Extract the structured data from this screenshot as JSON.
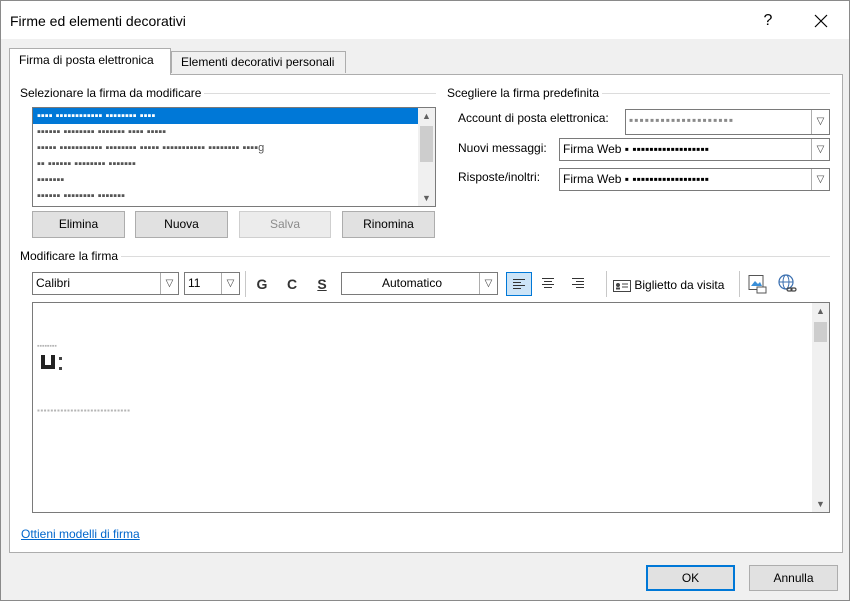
{
  "window": {
    "title": "Firme ed elementi decorativi",
    "help": "?",
    "close": "✕"
  },
  "tabs": [
    {
      "label": "Firma di posta elettronica",
      "active": true
    },
    {
      "label": "Elementi decorativi personali",
      "active": false
    }
  ],
  "select_group": {
    "label": "Selezionare la firma da modificare",
    "items": [
      "▪▪▪▪ ▪▪▪▪▪▪▪▪▪▪▪▪ ▪▪▪▪▪▪▪▪ ▪▪▪▪",
      "▪▪▪▪▪▪ ▪▪▪▪▪▪▪▪ ▪▪▪▪▪▪▪ ▪▪▪▪ ▪▪▪▪▪",
      "▪▪▪▪▪ ▪▪▪▪▪▪▪▪▪▪▪ ▪▪▪▪▪▪▪▪ ▪▪▪▪▪ ▪▪▪▪▪▪▪▪▪▪▪ ▪▪▪▪▪▪▪▪ ▪▪▪▪g",
      "▪▪ ▪▪▪▪▪▪ ▪▪▪▪▪▪▪▪ ▪▪▪▪▪▪▪",
      "▪▪▪▪▪▪▪",
      "▪▪▪▪▪▪ ▪▪▪▪▪▪▪▪ ▪▪▪▪▪▪▪"
    ],
    "buttons": {
      "delete": "Elimina",
      "new": "Nuova",
      "save": "Salva",
      "rename": "Rinomina"
    }
  },
  "default_group": {
    "label": "Scegliere la firma predefinita",
    "account_label": "Account di posta elettronica:",
    "account_value": "▪▪▪▪▪▪▪▪▪▪▪▪▪▪▪▪▪▪▪▪",
    "new_messages_label": "Nuovi messaggi:",
    "new_messages_value": "Firma Web ▪ ▪▪▪▪▪▪▪▪▪▪▪▪▪▪▪▪▪▪",
    "replies_label": "Risposte/inoltri:",
    "replies_value": "Firma Web ▪ ▪▪▪▪▪▪▪▪▪▪▪▪▪▪▪▪▪▪"
  },
  "edit_group": {
    "label": "Modificare la firma",
    "font": "Calibri",
    "size": "11",
    "bold": "G",
    "italic": "C",
    "underline": "S",
    "color": "Automatico",
    "business_card": "Biglietto da visita",
    "editor_lines": [
      "▪▪▪▪▪▪▪▪",
      "▪▪▪▪▪▪▪▪▪▪▪▪▪▪▪▪▪▪▪▪▪▪▪▪▪▪▪▪"
    ]
  },
  "link": "Ottieni modelli di firma",
  "footer": {
    "ok": "OK",
    "cancel": "Annulla"
  },
  "colors": {
    "accent": "#0078d7",
    "link": "#0066cc"
  }
}
